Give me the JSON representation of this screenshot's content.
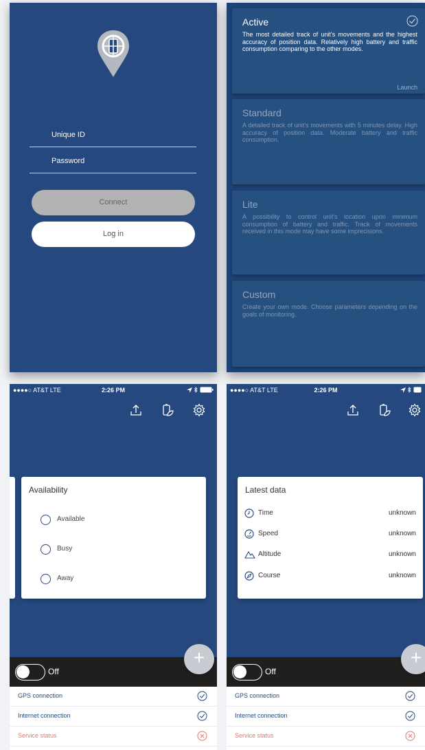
{
  "login": {
    "unique_id_placeholder": "Unique ID",
    "password_placeholder": "Password",
    "connect_label": "Connect",
    "login_label": "Log in"
  },
  "modes": [
    {
      "title": "Active",
      "desc": "The most detailed track of unit's movements and the highest accuracy of position data. Relatively high battery and traffic consumption comparing to the other modes.",
      "action": "Launch",
      "selected": true
    },
    {
      "title": "Standard",
      "desc": "A detailed track of unit's movements with 5 minutes delay. High accuracy of position data. Moderate battery and traffic consumption."
    },
    {
      "title": "Lite",
      "desc": "A possibility to control unit's location upon minimum consumption of battery and traffic. Track of movements received in this mode may have some imprecisions."
    },
    {
      "title": "Custom",
      "desc": "Create your own mode. Choose parameters depending on the goals of monitoring."
    }
  ],
  "status_bar": {
    "carrier": "●●●●○ AT&T  LTE",
    "time": "2:26 PM"
  },
  "toolbar_icons": [
    "upload-icon",
    "battery-leaf-icon",
    "gear-icon"
  ],
  "availability": {
    "title": "Availability",
    "options": [
      "Available",
      "Busy",
      "Away"
    ]
  },
  "latest_data": {
    "title": "Latest data",
    "rows": [
      {
        "label": "Time",
        "value": "unknown",
        "icon": "clock-icon"
      },
      {
        "label": "Speed",
        "value": "unknown",
        "icon": "speedometer-icon"
      },
      {
        "label": "Altitude",
        "value": "unknown",
        "icon": "mountain-icon"
      },
      {
        "label": "Course",
        "value": "unknown",
        "icon": "compass-icon"
      }
    ]
  },
  "fab_label": "+",
  "toggle_label": "Off",
  "status_list": [
    {
      "label": "GPS connection",
      "state": "ok"
    },
    {
      "label": "Internet connection",
      "state": "ok"
    },
    {
      "label": "Service status",
      "state": "error"
    }
  ],
  "colors": {
    "brand_blue": "#25497f",
    "ok_blue": "#25497f",
    "error_red": "#f0726c"
  }
}
